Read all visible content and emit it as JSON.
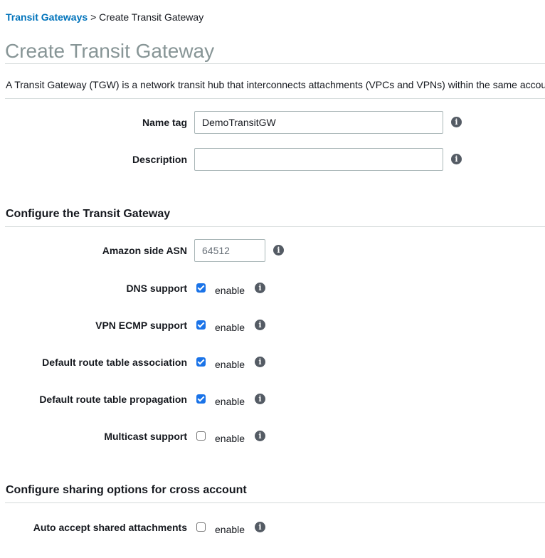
{
  "breadcrumb": {
    "parent": "Transit Gateways",
    "separator": ">",
    "current": "Create Transit Gateway"
  },
  "page": {
    "title": "Create Transit Gateway",
    "description": "A Transit Gateway (TGW) is a network transit hub that interconnects attachments (VPCs and VPNs) within the same account or across accounts."
  },
  "general": {
    "name_tag": {
      "label": "Name tag",
      "value": "DemoTransitGW"
    },
    "description": {
      "label": "Description",
      "value": ""
    }
  },
  "configure": {
    "title": "Configure the Transit Gateway",
    "asn": {
      "label": "Amazon side ASN",
      "placeholder": "64512"
    },
    "options": [
      {
        "label": "DNS support",
        "option": "enable",
        "checked": true
      },
      {
        "label": "VPN ECMP support",
        "option": "enable",
        "checked": true
      },
      {
        "label": "Default route table association",
        "option": "enable",
        "checked": true
      },
      {
        "label": "Default route table propagation",
        "option": "enable",
        "checked": true
      },
      {
        "label": "Multicast support",
        "option": "enable",
        "checked": false
      }
    ]
  },
  "sharing": {
    "title": "Configure sharing options for cross account",
    "options": [
      {
        "label": "Auto accept shared attachments",
        "option": "enable",
        "checked": false
      }
    ]
  },
  "icons": {
    "info": "info-icon",
    "info_glyph": "i"
  },
  "colors": {
    "link": "#0073bb",
    "title": "#879596",
    "checkbox_checked": "#1a73e8",
    "info_icon": "#545b64",
    "divider": "#d5dbdb"
  }
}
